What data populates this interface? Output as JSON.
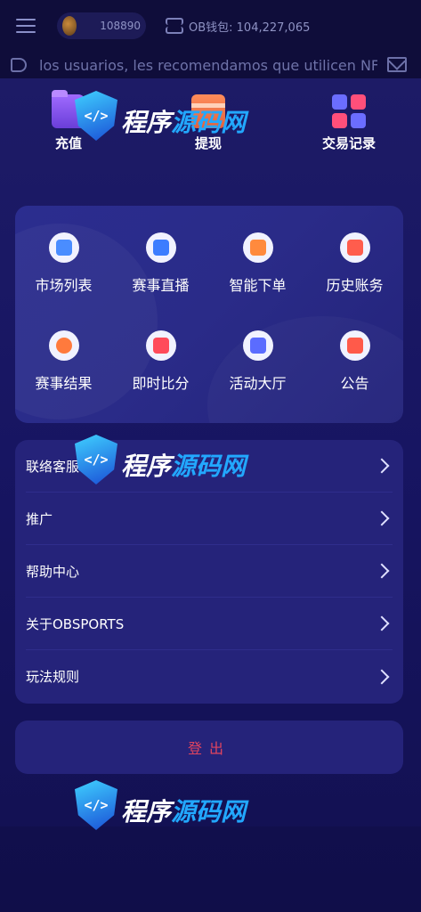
{
  "topbar": {
    "balance": "108890",
    "wallet_label": "OB钱包: 104,227,065"
  },
  "marquee": {
    "text": "los usuarios, les recomendamos que utilicen NF"
  },
  "quick_actions": [
    {
      "label": "充值",
      "icon": "folder-icon"
    },
    {
      "label": "提现",
      "icon": "card-icon"
    },
    {
      "label": "交易记录",
      "icon": "grid-icon"
    }
  ],
  "features": [
    {
      "label": "市场列表",
      "icon": "document-icon",
      "color": "#4a8dff"
    },
    {
      "label": "赛事直播",
      "icon": "tv-icon",
      "color": "#3c7dff"
    },
    {
      "label": "智能下单",
      "icon": "edit-icon",
      "color": "#ff8a3d"
    },
    {
      "label": "历史账务",
      "icon": "clock-icon",
      "color": "#ff5d4d"
    },
    {
      "label": "赛事结果",
      "icon": "star-icon",
      "color": "#ff7a3d"
    },
    {
      "label": "即时比分",
      "icon": "scoreboard-icon",
      "color": "#ff4a5a"
    },
    {
      "label": "活动大厅",
      "icon": "flag-icon",
      "color": "#5b6cff"
    },
    {
      "label": "公告",
      "icon": "megaphone-icon",
      "color": "#ff5a4a"
    }
  ],
  "menu": [
    {
      "label": "联络客服"
    },
    {
      "label": "推广"
    },
    {
      "label": "帮助中心"
    },
    {
      "label": "关于OBSPORTS"
    },
    {
      "label": "玩法规则"
    }
  ],
  "logout_label": "登出",
  "watermark": {
    "part1": "程序",
    "part2": "源码网",
    "badge": "</>"
  }
}
